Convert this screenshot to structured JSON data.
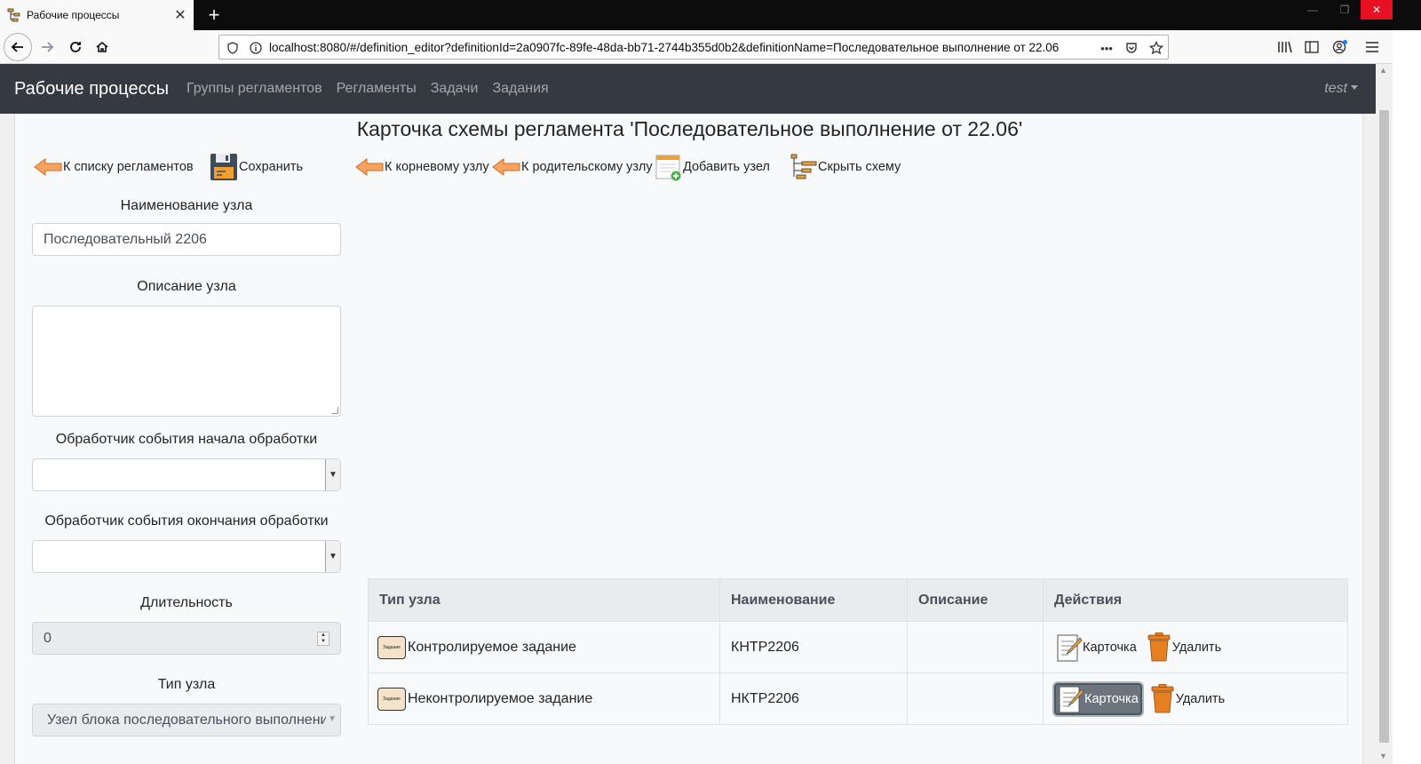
{
  "browser": {
    "tab_title": "Рабочие процессы",
    "url": "localhost:8080/#/definition_editor?definitionId=2a0907fc-89fe-48da-bb71-2744b355d0b2&definitionName=Последовательное выполнение от 22.06"
  },
  "nav": {
    "brand": "Рабочие процессы",
    "links": [
      "Группы регламентов",
      "Регламенты",
      "Задачи",
      "Задания"
    ],
    "user": "test"
  },
  "page": {
    "title": "Карточка схемы регламента 'Последовательное выполнение от 22.06'"
  },
  "toolbar": {
    "back_to_list": "К списку регламентов",
    "save": "Сохранить",
    "to_root": "К корневому узлу",
    "to_parent": "К родительскому узлу",
    "add_node": "Добавить узел",
    "hide_schema": "Скрыть схему"
  },
  "form": {
    "name_label": "Наименование узла",
    "name_value": "Последовательный 2206",
    "description_label": "Описание узла",
    "description_value": "",
    "start_handler_label": "Обработчик события начала обработки",
    "start_handler_value": "",
    "end_handler_label": "Обработчик события окончания обработки",
    "end_handler_value": "",
    "duration_label": "Длительность",
    "duration_value": "0",
    "node_type_label": "Тип узла",
    "node_type_value": "Узел блока последовательного выполнения"
  },
  "table": {
    "headers": [
      "Тип узла",
      "Наименование",
      "Описание",
      "Действия"
    ],
    "rows": [
      {
        "type": "Контролируемое задание",
        "name": "КНТР2206",
        "description": "",
        "card": "Карточка",
        "delete": "Удалить"
      },
      {
        "type": "Неконтролируемое задание",
        "name": "НКТР2206",
        "description": "",
        "card": "Карточка",
        "delete": "Удалить"
      }
    ],
    "task_icon_text": "Задание"
  }
}
